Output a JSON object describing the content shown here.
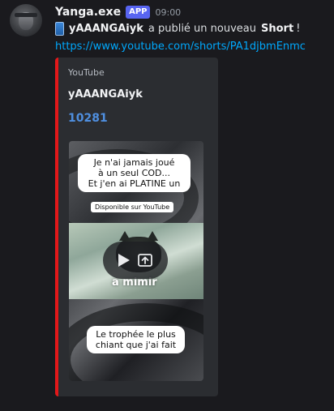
{
  "message": {
    "username": "Yanga.exe",
    "badge": "APP",
    "time": "09:00",
    "channel": "yAAANGAiyk",
    "text_middle": "a publié un nouveau",
    "short_word": "Short",
    "text_end": "!",
    "link": "https://www.youtube.com/shorts/PA1djbmEnmc"
  },
  "embed": {
    "provider": "YouTube",
    "title": "yAAANGAiyk",
    "count": "10281",
    "accent_color": "#e3181a",
    "video": {
      "caption_top_line1": "Je n'ai jamais joué",
      "caption_top_line2": "à un seul COD...",
      "caption_top_line3": "Et j'en ai PLATINE un",
      "pill": "Disponible sur YouTube",
      "center_text": "a mimir",
      "caption_bottom_line1": "Le trophée le plus",
      "caption_bottom_line2": "chiant que j'ai fait"
    }
  },
  "icons": {
    "phone": "mobile-phone-icon",
    "play": "play-icon",
    "open": "open-external-icon"
  }
}
